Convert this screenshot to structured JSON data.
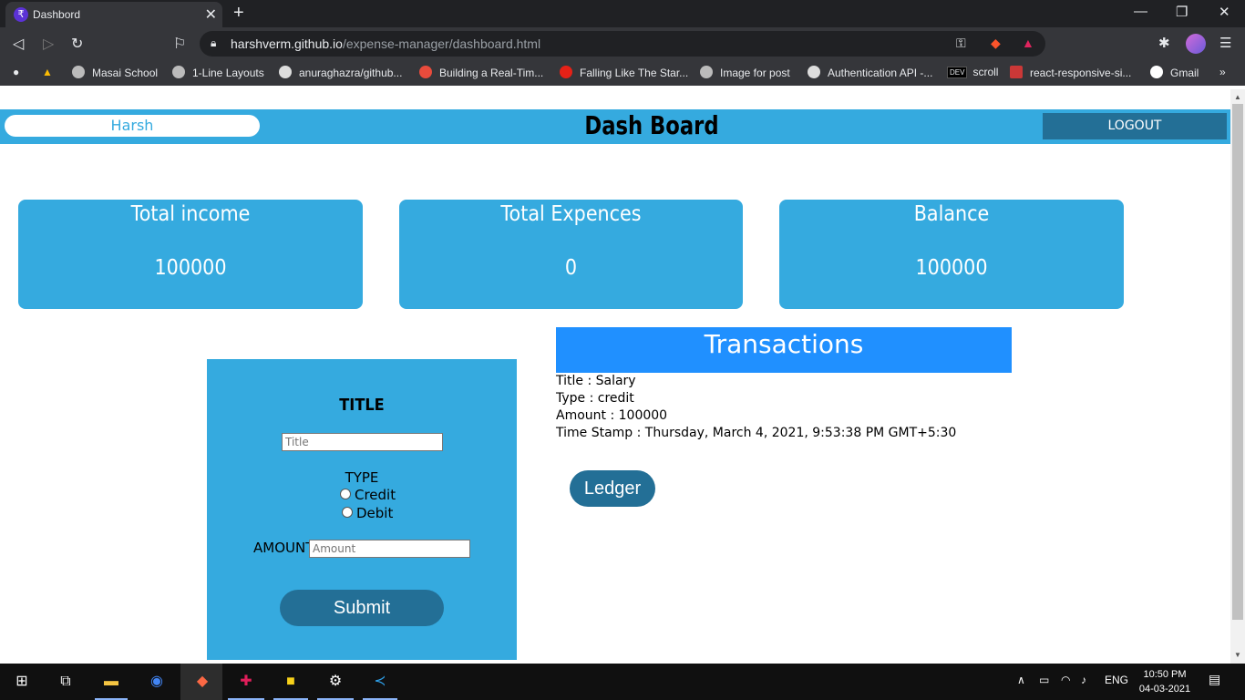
{
  "browser": {
    "tab_title": "Dashbord",
    "url_host": "harshverm.github.io",
    "url_path": "/expense-manager/dashboard.html",
    "bookmarks": [
      {
        "label": "Masai School",
        "icon": "globe-icon"
      },
      {
        "label": "1-Line Layouts",
        "icon": "globe-icon"
      },
      {
        "label": "anuraghazra/github...",
        "icon": "github-icon"
      },
      {
        "label": "Building a Real-Tim...",
        "icon": "asterisk-icon"
      },
      {
        "label": "Falling Like The Star...",
        "icon": "youtube-icon"
      },
      {
        "label": "Image for post",
        "icon": "globe-icon"
      },
      {
        "label": "Authentication API -...",
        "icon": "github-icon"
      },
      {
        "label": "scroll",
        "icon": "dev-icon"
      },
      {
        "label": "react-responsive-si...",
        "icon": "npm-icon"
      },
      {
        "label": "Gmail",
        "icon": "google-icon"
      }
    ],
    "dev_badge": "DEV",
    "more": "»"
  },
  "header": {
    "user_name": "Harsh",
    "title": "Dash Board",
    "logout_label": "LOGOUT"
  },
  "cards": [
    {
      "title": "Total income",
      "value": "100000"
    },
    {
      "title": "Total Expences",
      "value": "0"
    },
    {
      "title": "Balance",
      "value": "100000"
    }
  ],
  "form": {
    "heading": "TITLE",
    "title_placeholder": "Title",
    "type_label": "TYPE",
    "credit_label": "Credit",
    "debit_label": "Debit",
    "amount_label": "AMOUNT",
    "amount_placeholder": "Amount",
    "submit_label": "Submit"
  },
  "transactions": {
    "heading": "Transactions",
    "lines": [
      "Title : Salary",
      "Type : credit",
      "Amount : 100000",
      "Time Stamp : Thursday, March 4, 2021, 9:53:38 PM GMT+5:30"
    ],
    "ledger_label": "Ledger"
  },
  "taskbar": {
    "lang": "ENG",
    "time": "10:50 PM",
    "date": "04-03-2021"
  },
  "colors": {
    "accent": "#35aadf",
    "dark_button": "#236f96",
    "transactions_header": "#2090ff"
  }
}
